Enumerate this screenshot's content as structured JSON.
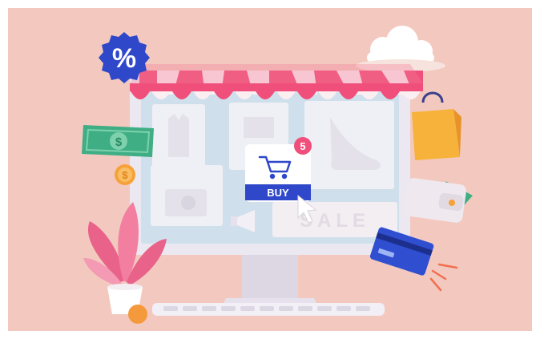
{
  "scene": {
    "discount_badge": "%",
    "cart_tile": {
      "buy_label": "BUY",
      "cart_count": "5"
    },
    "sale_banner": "SALE",
    "coin_symbol": "$",
    "banknote_symbol": "$"
  },
  "colors": {
    "background": "#f3c9bf",
    "awning_pink": "#ef4f7a",
    "awning_white": "#fbeff2",
    "monitor_frame": "#ece8f1",
    "screen": "#cfe0ec",
    "badge_blue": "#2f47c9",
    "bag_yellow": "#f6b23a",
    "banknote_green": "#3fae84",
    "plant_pink": "#e9628a",
    "card_blue": "#2f4fd0"
  },
  "icons": [
    "discount-badge-icon",
    "cloud-icon",
    "shopping-bag-icon",
    "banknote-icon",
    "coin-icon",
    "wallet-icon",
    "credit-card-icon",
    "cart-icon",
    "cursor-arrow-icon",
    "megaphone-icon",
    "plant-icon"
  ]
}
